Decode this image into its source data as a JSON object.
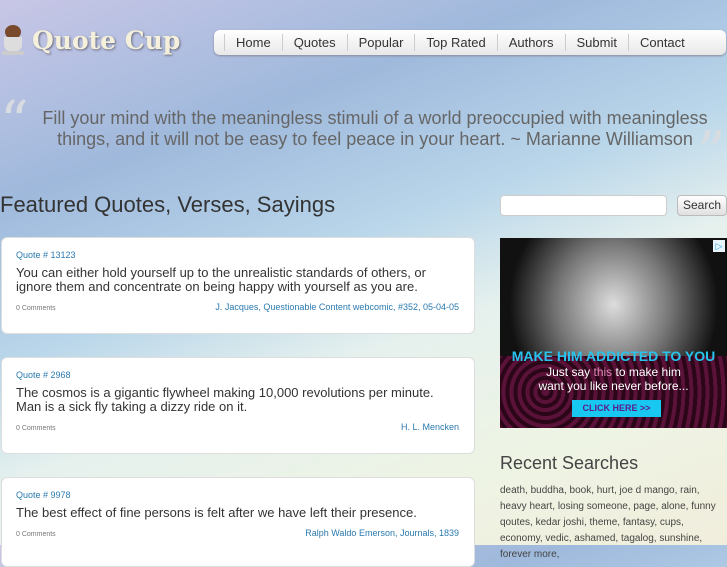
{
  "site": {
    "name": "Quote Cup"
  },
  "nav": [
    "Home",
    "Quotes",
    "Popular",
    "Top Rated",
    "Authors",
    "Submit",
    "Contact"
  ],
  "hero": {
    "quote": "Fill your mind with the meaningless stimuli of a world preoccupied with meaningless things, and it will not be easy to feel peace in your heart. ~ Marianne Williamson"
  },
  "main": {
    "title": "Featured Quotes, Verses, Sayings",
    "quotes": [
      {
        "number": "Quote # 13123",
        "text": "You can either hold yourself up to the unrealistic standards of others, or ignore them and concentrate on being happy with yourself as you are.",
        "comments": "0 Comments",
        "author": "J. Jacques, Questionable Content webcomic, #352, 05-04-05"
      },
      {
        "number": "Quote # 2968",
        "text": "The cosmos is a gigantic flywheel making 10,000 revolutions per minute. Man is a sick fly taking a dizzy ride on it.",
        "comments": "0 Comments",
        "author": "H. L. Mencken"
      },
      {
        "number": "Quote # 9978",
        "text": "The best effect of fine persons is felt after we have left their presence.",
        "comments": "0 Comments",
        "author": "Ralph Waldo Emerson, Journals, 1839"
      }
    ]
  },
  "sidebar": {
    "search_button": "Search",
    "search_value": "",
    "ad": {
      "headline": "MAKE HIM ADDICTED TO YOU",
      "line1a": "Just say ",
      "line1b": "this",
      "line1c": " to make him",
      "line2": "want you like never before...",
      "button": "CLICK HERE >>"
    },
    "recent_title": "Recent Searches",
    "recent": "death, buddha, book, hurt, joe d mango, rain, heavy heart, losing someone, page, alone, funny qoutes, kedar joshi, theme, fantasy, cups, economy, vedic, ashamed, tagalog, sunshine, forever more,"
  }
}
